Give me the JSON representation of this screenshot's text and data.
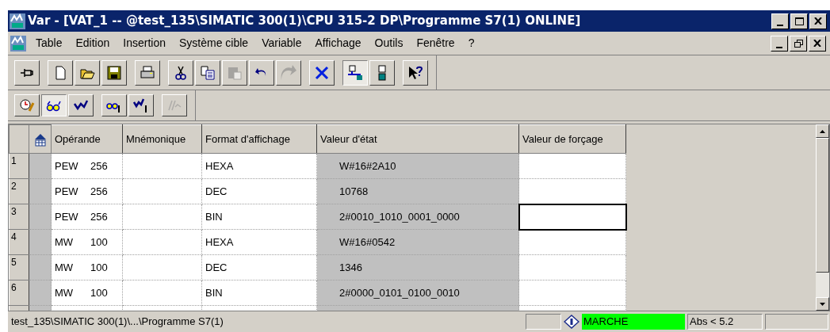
{
  "window": {
    "title": "Var - [VAT_1 -- @test_135\\SIMATIC 300(1)\\CPU 315-2 DP\\Programme S7(1)  ONLINE]"
  },
  "menu": [
    "Table",
    "Edition",
    "Insertion",
    "Système cible",
    "Variable",
    "Affichage",
    "Outils",
    "Fenêtre",
    "?"
  ],
  "toolbar": [
    {
      "kind": "pin",
      "pressed": false,
      "disabled": false
    },
    {
      "kind": "new",
      "pressed": false,
      "disabled": false
    },
    {
      "kind": "open",
      "pressed": false,
      "disabled": false
    },
    {
      "kind": "save",
      "pressed": false,
      "disabled": false
    },
    {
      "kind": "print",
      "pressed": false,
      "disabled": false
    },
    {
      "kind": "cut",
      "pressed": false,
      "disabled": false
    },
    {
      "kind": "copy",
      "pressed": false,
      "disabled": false
    },
    {
      "kind": "paste",
      "pressed": false,
      "disabled": true
    },
    {
      "kind": "undo",
      "pressed": false,
      "disabled": false
    },
    {
      "kind": "redo",
      "pressed": false,
      "disabled": true
    },
    {
      "kind": "delete",
      "pressed": false,
      "disabled": false
    },
    {
      "kind": "online",
      "pressed": true,
      "disabled": false
    },
    {
      "kind": "station",
      "pressed": false,
      "disabled": false
    },
    {
      "kind": "help",
      "pressed": false,
      "disabled": false
    }
  ],
  "toolbar2": [
    {
      "kind": "trigger",
      "pressed": false,
      "disabled": false
    },
    {
      "kind": "monitor",
      "pressed": true,
      "disabled": false
    },
    {
      "kind": "modify",
      "pressed": false,
      "disabled": false
    },
    {
      "kind": "monitor-once",
      "pressed": false,
      "disabled": false
    },
    {
      "kind": "modify-once",
      "pressed": false,
      "disabled": false
    },
    {
      "kind": "enable",
      "pressed": false,
      "disabled": true
    }
  ],
  "table": {
    "columns": [
      "Opérande",
      "Mnémonique",
      "Format d'affichage",
      "Valeur d'état",
      "Valeur de forçage"
    ],
    "rows": [
      {
        "number": "1",
        "operand": "PEW",
        "address": "256",
        "format": "HEXA",
        "status": "W#16#2A10",
        "selected": false
      },
      {
        "number": "2",
        "operand": "PEW",
        "address": "256",
        "format": "DEC",
        "status": "10768",
        "selected": false
      },
      {
        "number": "3",
        "operand": "PEW",
        "address": "256",
        "format": "BIN",
        "status": "2#0010_1010_0001_0000",
        "selected": true
      },
      {
        "number": "4",
        "operand": "MW",
        "address": "100",
        "format": "HEXA",
        "status": "W#16#0542",
        "selected": false
      },
      {
        "number": "5",
        "operand": "MW",
        "address": "100",
        "format": "DEC",
        "status": "1346",
        "selected": false
      },
      {
        "number": "6",
        "operand": "MW",
        "address": "100",
        "format": "BIN",
        "status": "2#0000_0101_0100_0010",
        "selected": false
      }
    ]
  },
  "status_bar": {
    "path": "test_135\\SIMATIC 300(1)\\...\\Programme S7(1)",
    "mode": "MARCHE",
    "address": "Abs < 5.2"
  }
}
